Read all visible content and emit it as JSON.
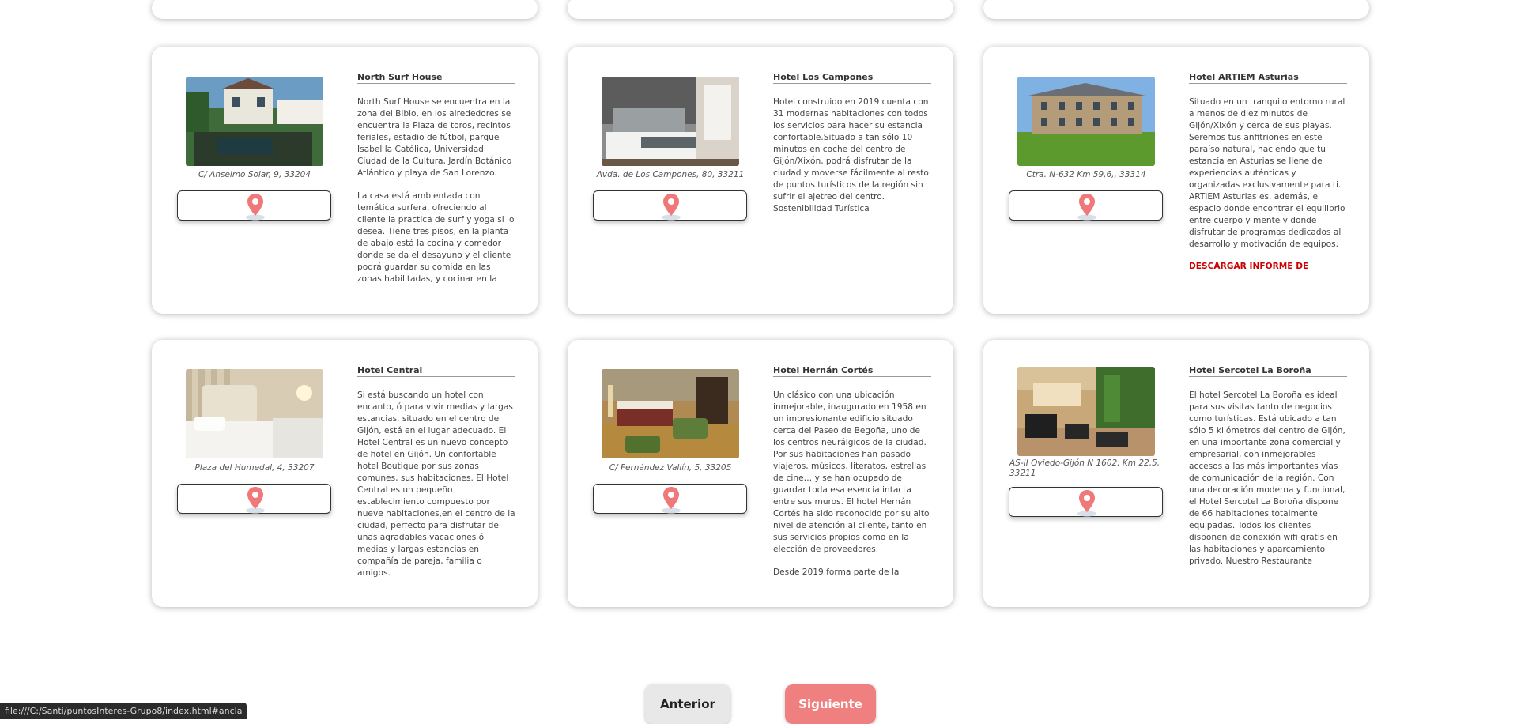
{
  "cards": [
    {
      "name": "North Surf House",
      "address": "C/ Anselmo Solar, 9, 33204",
      "descriptions": [
        "North Surf House se encuentra en la zona del Bibio, en los alrededores se encuentra la Plaza de toros, recintos feriales, estadio de fútbol, parque Isabel la Católica, Universidad Ciudad de la Cultura, Jardín Botánico Atlántico y playa de San Lorenzo.",
        "La casa está ambientada con temática surfera, ofreciendo al cliente la practica de surf y yoga si lo desea. Tiene tres pisos, en la planta de abajo está la cocina y comedor donde se da el desayuno y el cliente podrá guardar su comida en las zonas habilitadas, y cocinar en la"
      ]
    },
    {
      "name": "Hotel Los Campones",
      "address": "Avda. de Los Campones, 80, 33211",
      "descriptions": [
        "Hotel construido en 2019 cuenta con 31 modernas habitaciones con todos los servicios para hacer su estancia confortable.Situado a tan sólo 10 minutos en coche del centro de Gijón/Xixón, podrá disfrutar de la ciudad y moverse fácilmente al resto de puntos turísticos de la región sin sufrir el ajetreo del centro.\n  Sostenibilidad Turística"
      ]
    },
    {
      "name": "Hotel ARTIEM Asturias",
      "address": "Ctra. N-632 Km 59,6,, 33314",
      "descriptions": [
        "Situado en un tranquilo entorno rural a menos de diez minutos de Gijón/Xixón y cerca de sus playas. Seremos tus anfitriones en este paraíso natural, haciendo que tu estancia en Asturias se llene de experiencias auténticas y organizadas exclusivamente para ti. ARTIEM Asturias es, además, el espacio donde encontrar el equilibrio entre cuerpo y mente y donde disfrutar de programas dedicados al desarrollo y motivación de equipos."
      ],
      "link": "DESCARGAR INFORME DE"
    },
    {
      "name": "Hotel Central",
      "address": "Plaza del Humedal, 4, 33207",
      "descriptions": [
        "Si está buscando un hotel con encanto, ó para vivir medias y largas estancias, situado en el centro de Gijón, está en  el lugar adecuado. El Hotel Central es un nuevo concepto de  hotel en Gijón. Un confortable hotel Boutique por sus zonas comunes, sus habitaciones. El Hotel Central es un  pequeño establecimiento compuesto por nueve habitaciones,en el centro de la ciudad,  perfecto para disfrutar de unas agradables vacaciones ó medias y largas estancias  en compañía de pareja, familia o amigos."
      ]
    },
    {
      "name": "Hotel Hernán Cortés",
      "address": "C/ Fernández Vallín, 5, 33205",
      "descriptions": [
        "Un clásico con una ubicación inmejorable, inaugurado en 1958 en un impresionante edificio situado cerca del Paseo de Begoña, uno de los centros neurálgicos de la ciudad. Por sus habitaciones han pasado viajeros, músicos, literatos, estrellas de cine… y se han ocupado de guardar toda esa esencia intacta entre sus muros. El hotel Hernán Cortés ha sido reconocido por su alto nivel de atención al cliente, tanto en sus servicios propios como en la elección de proveedores.",
        "Desde 2019 forma parte de la"
      ]
    },
    {
      "name": "Hotel Sercotel La Boroña",
      "address": "AS-II Oviedo-Gijón N 1602. Km 22,5, 33211",
      "descriptions": [
        "El hotel Sercotel La Boroña es  ideal para sus visitas tanto de negocios como turísticas. Está ubicado a tan sólo 5 kilómetros del centro de Gijón, en una importante zona comercial y empresarial, con inmejorables accesos a las más importantes vías de comunicación de la región. Con una decoración moderna y funcional, el Hotel Sercotel La Boroña dispone de 66 habitaciones totalmente equipadas. Todos los clientes disponen de conexión wifi gratis en las habitaciones y aparcamiento privado. Nuestro Restaurante"
      ]
    }
  ],
  "pagination": {
    "prev_label": "Anterior",
    "next_label": "Siguiente"
  },
  "statusbar": "file:///C:/Santi/puntosInteres-Grupo8/index.html#ancla",
  "colors": {
    "accent": "#f08080",
    "pin": "#f07878"
  }
}
